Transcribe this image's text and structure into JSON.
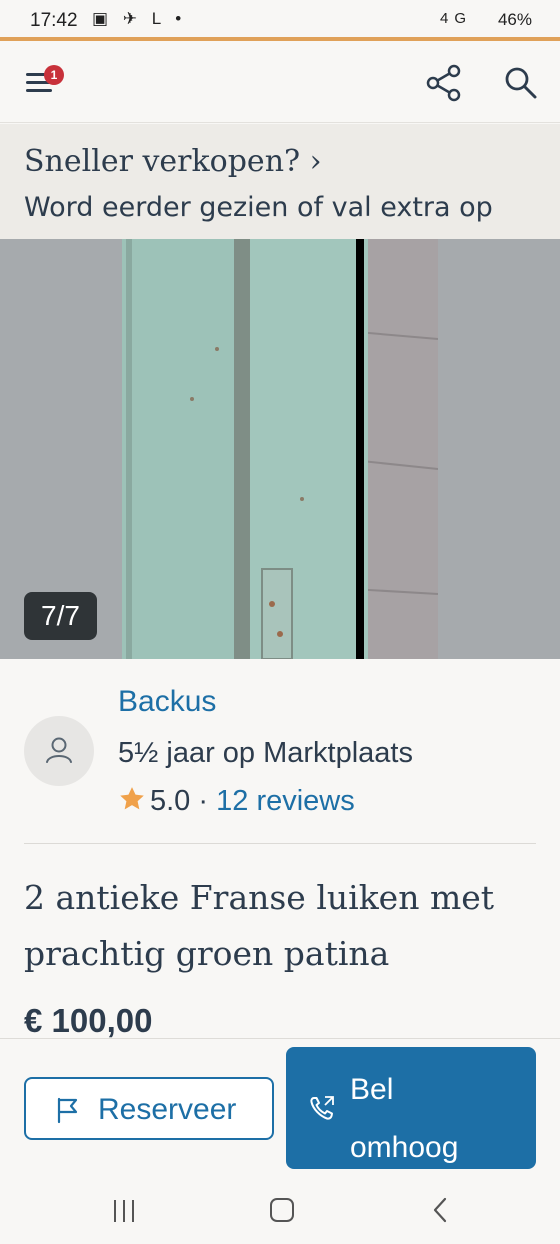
{
  "status_bar": {
    "time": "17:42",
    "left_icons": "▣ ✈ L •",
    "network": "4G",
    "battery": "46%"
  },
  "header": {
    "menu_badge": "1",
    "icons": [
      "menu-icon",
      "share-icon",
      "search-icon"
    ]
  },
  "promo": {
    "title": "Sneller verkopen? ›",
    "subtitle": "Word eerder gezien of val extra op"
  },
  "gallery": {
    "counter": "7/7"
  },
  "seller": {
    "name": "Backus",
    "member_since": "5½ jaar op Marktplaats",
    "rating": "5.0",
    "separator": "·",
    "reviews": "12 reviews"
  },
  "listing": {
    "title": "2 antieke Franse luiken met prachtig groen patina",
    "price": "€ 100,00"
  },
  "actions": {
    "reserve_label": "Reserveer",
    "call_label": "Bel omhoog"
  },
  "colors": {
    "accent": "#1d6fa6",
    "text": "#2d3c4d",
    "badge": "#c8313a",
    "orange_line": "#e0a159",
    "star": "#f0a14a"
  }
}
